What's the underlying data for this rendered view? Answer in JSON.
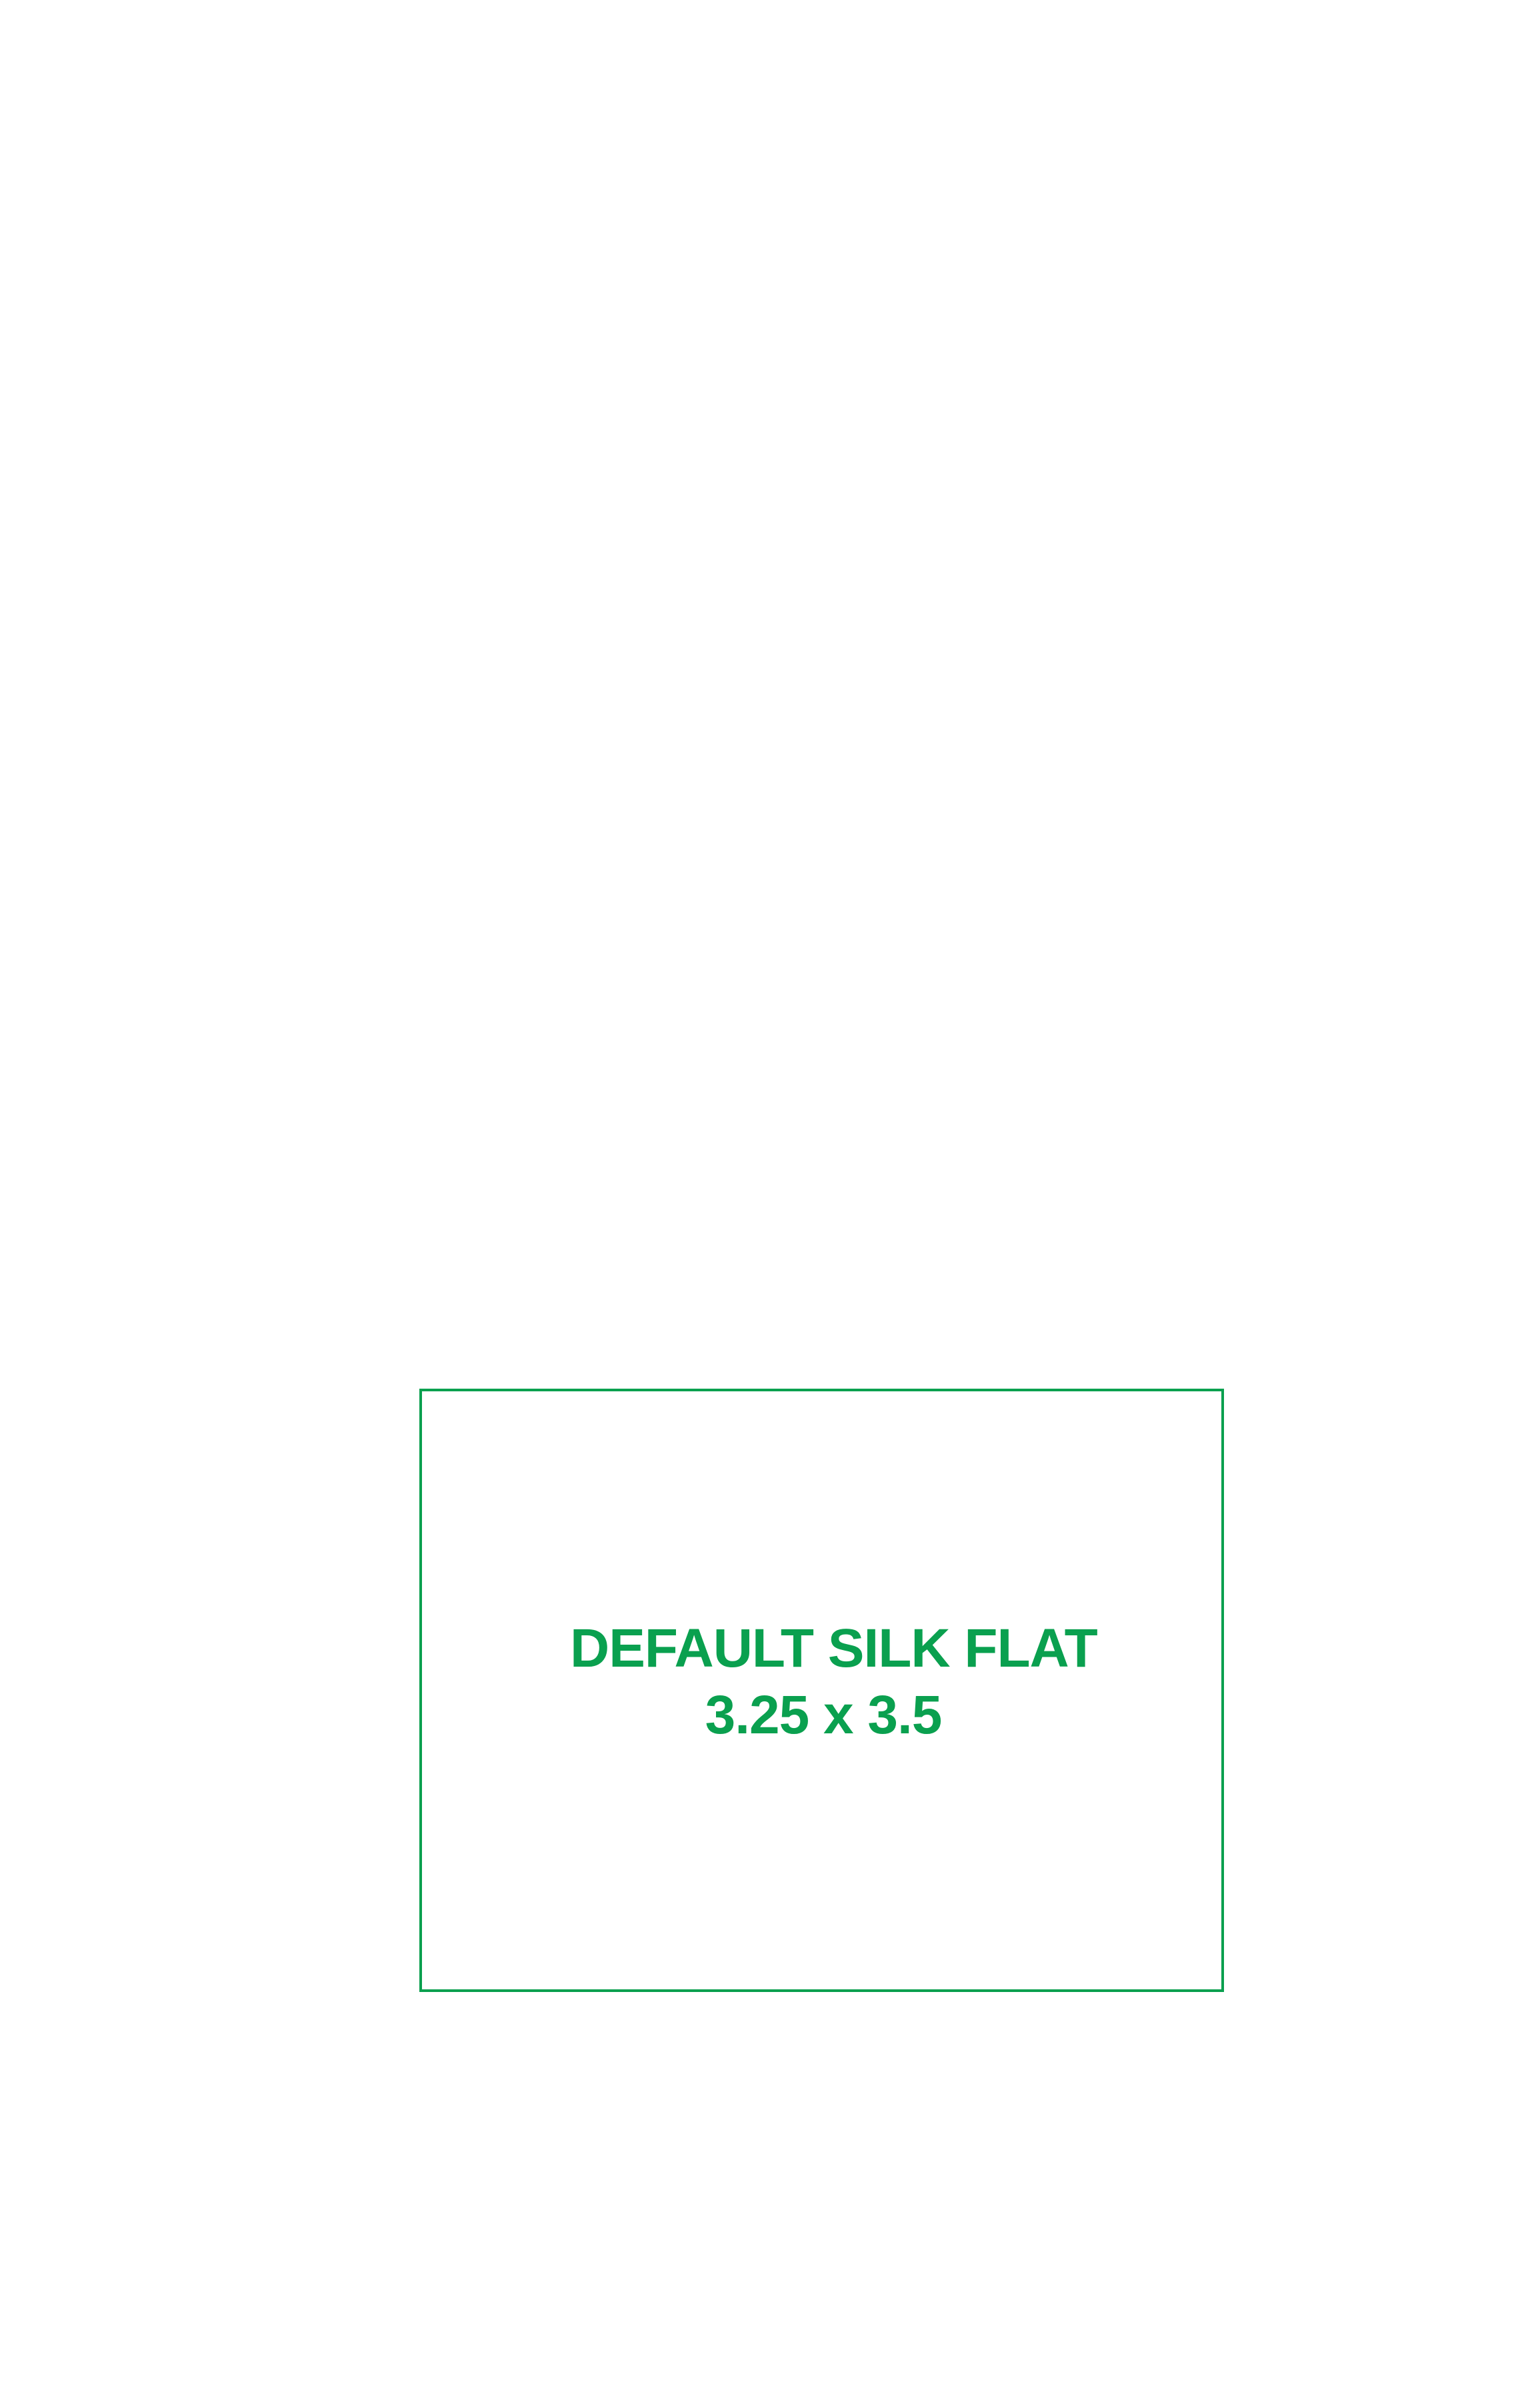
{
  "colors": {
    "background": "#ffffff",
    "accent": "#0aa04f"
  },
  "template": {
    "name": "DEFAULT SILK FLAT",
    "size": "3.25 x 3.5"
  }
}
